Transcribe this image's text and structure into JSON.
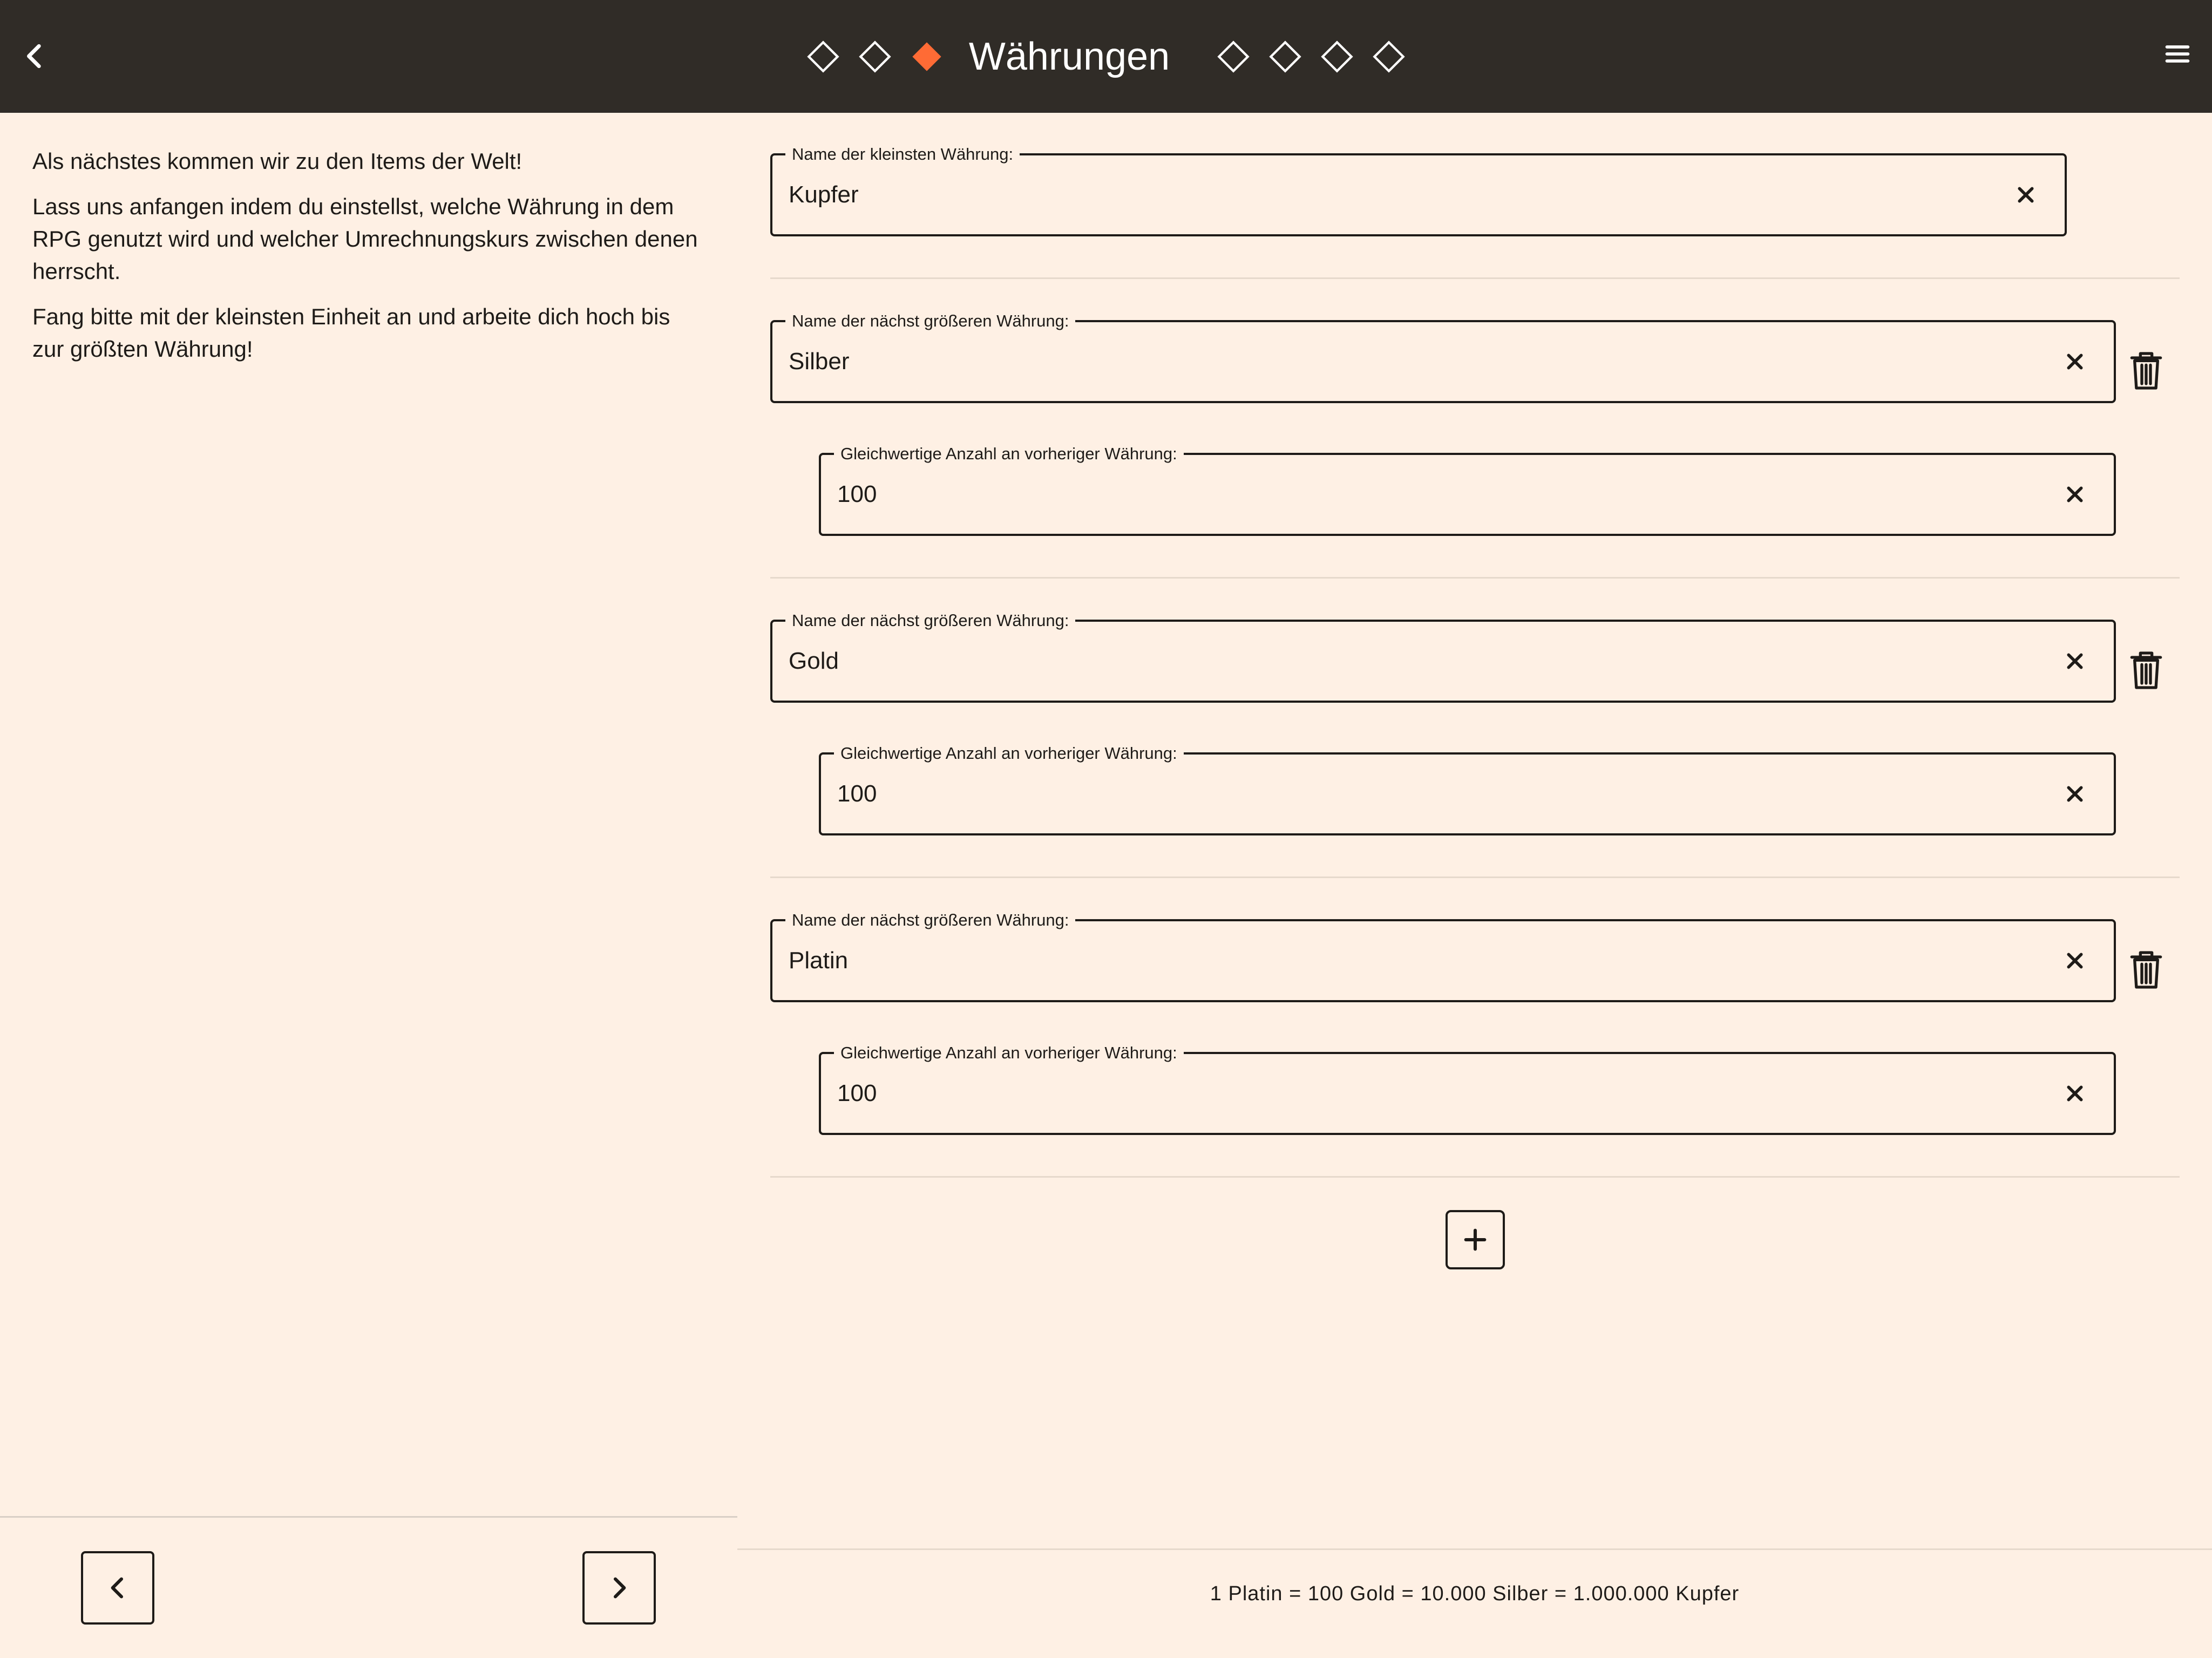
{
  "header": {
    "title": "Währungen",
    "accent_color": "#ff6b35",
    "steps_before": 2,
    "steps_after": 4,
    "back_icon": "chevron-left-icon",
    "menu_icon": "hamburger-menu-icon"
  },
  "intro": {
    "paragraphs": [
      "Als nächstes kommen wir zu den Items der Welt!",
      "Lass uns anfangen indem du einstellst, welche Währung in dem RPG genutzt wird und welcher Umrechnungskurs zwischen denen herrscht.",
      "Fang bitte mit der kleinsten Einheit an und arbeite dich hoch bis zur größten Währung!"
    ]
  },
  "base_currency": {
    "label": "Name der kleinsten Währung:",
    "value": "Kupfer"
  },
  "currencies": [
    {
      "name_label": "Name der nächst größeren Währung:",
      "name": "Silber",
      "rate_label": "Gleichwertige Anzahl an vorheriger Währung:",
      "rate": "100"
    },
    {
      "name_label": "Name der nächst größeren Währung:",
      "name": "Gold",
      "rate_label": "Gleichwertige Anzahl an vorheriger Währung:",
      "rate": "100"
    },
    {
      "name_label": "Name der nächst größeren Währung:",
      "name": "Platin",
      "rate_label": "Gleichwertige Anzahl an vorheriger Währung:",
      "rate": "100"
    }
  ],
  "summary": "1 Platin = 100 Gold = 10.000 Silber = 1.000.000 Kupfer",
  "icons": {
    "clear": "close-icon",
    "delete": "trash-icon",
    "add": "plus-icon",
    "prev": "chevron-left-icon",
    "next": "chevron-right-icon"
  }
}
